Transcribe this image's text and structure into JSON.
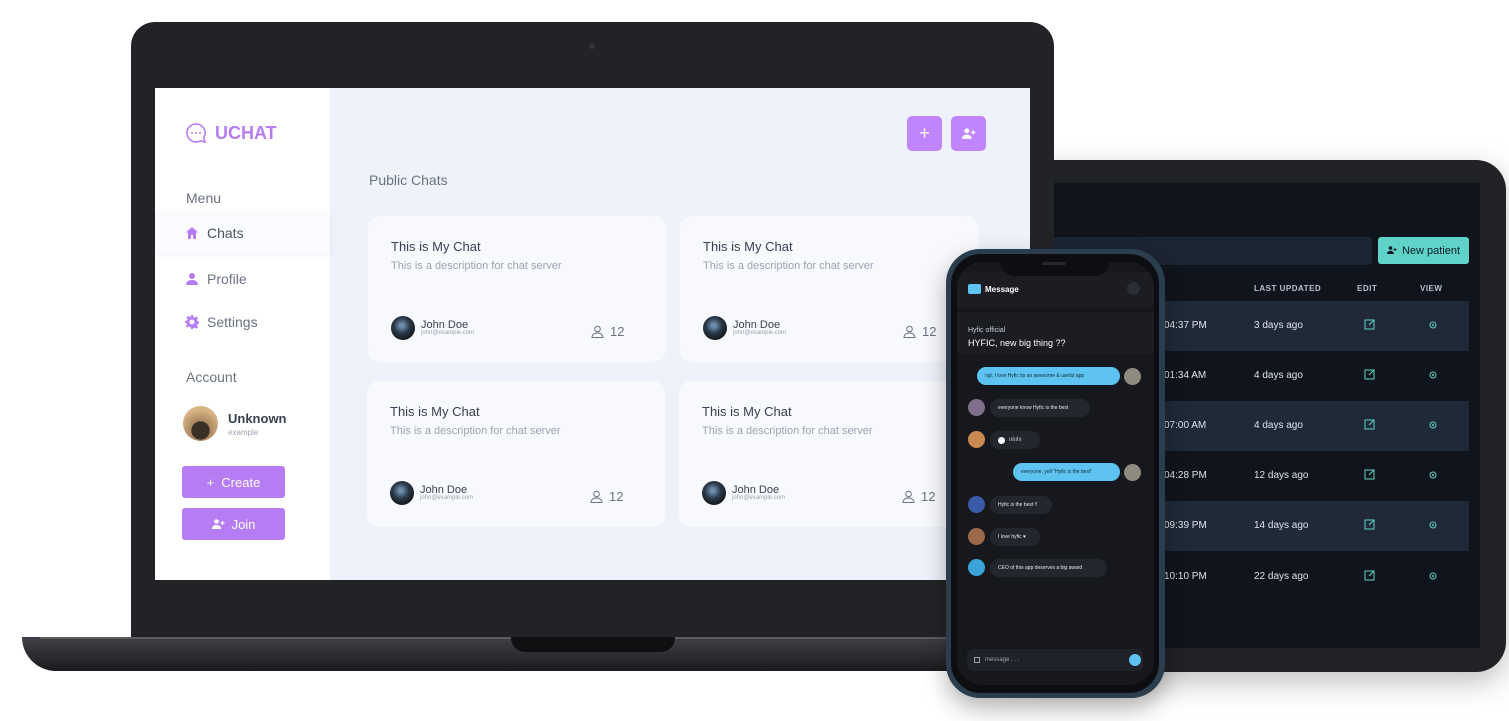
{
  "laptop": {
    "app_name": "UCHAT",
    "menu_label": "Menu",
    "nav": [
      {
        "label": "Chats",
        "icon": "home-icon"
      },
      {
        "label": "Profile",
        "icon": "user-icon"
      },
      {
        "label": "Settings",
        "icon": "gear-icon"
      }
    ],
    "account_label": "Account",
    "user": {
      "name": "Unknown",
      "email": "example"
    },
    "create_label": "Create",
    "join_label": "Join",
    "section_title": "Public Chats",
    "cards": [
      {
        "title": "This is My Chat",
        "description": "This is a description for chat server",
        "owner": "John Doe",
        "owner_email": "john@example.com",
        "members": "12"
      },
      {
        "title": "This is My Chat",
        "description": "This is a description for chat server",
        "owner": "John Doe",
        "owner_email": "john@example.com",
        "members": "12"
      },
      {
        "title": "This is My Chat",
        "description": "This is a description for chat server",
        "owner": "John Doe",
        "owner_email": "john@example.com",
        "members": "12"
      },
      {
        "title": "This is My Chat",
        "description": "This is a description for chat server",
        "owner": "John Doe",
        "owner_email": "john@example.com",
        "members": "12"
      }
    ],
    "accent": "#b57cf3"
  },
  "tablet": {
    "new_button": "New patient",
    "headers": {
      "last_updated": "LAST UPDATED",
      "edit": "EDIT",
      "view": "VIEW"
    },
    "rows": [
      {
        "time": "04:37 PM",
        "ago": "3 days ago"
      },
      {
        "time": "01:34 AM",
        "ago": "4 days ago"
      },
      {
        "time": "07:00 AM",
        "ago": "4 days ago"
      },
      {
        "time": "04:28 PM",
        "ago": "12 days ago"
      },
      {
        "time": "09:39 PM",
        "ago": "14 days ago"
      },
      {
        "time": "10:10 PM",
        "ago": "22 days ago"
      }
    ],
    "accent": "#5fd3c7"
  },
  "phone": {
    "header_title": "Message",
    "channel_name": "Hyfic official",
    "channel_headline": "HYFIC, new big thing ??",
    "messages": [
      {
        "text": "ngl, I love Hyfic its an awesome & useful app"
      },
      {
        "text": "everyone know Hyfic is the best"
      },
      {
        "text": "everyone, yell \"Hyfic is the best\""
      },
      {
        "text": "Hyfic is the best !!"
      },
      {
        "text": "I love hyfic ♥"
      },
      {
        "text": "CEO of this app deserves a big award"
      }
    ],
    "input_placeholder": "message . . .",
    "accent": "#5ec3f0"
  }
}
